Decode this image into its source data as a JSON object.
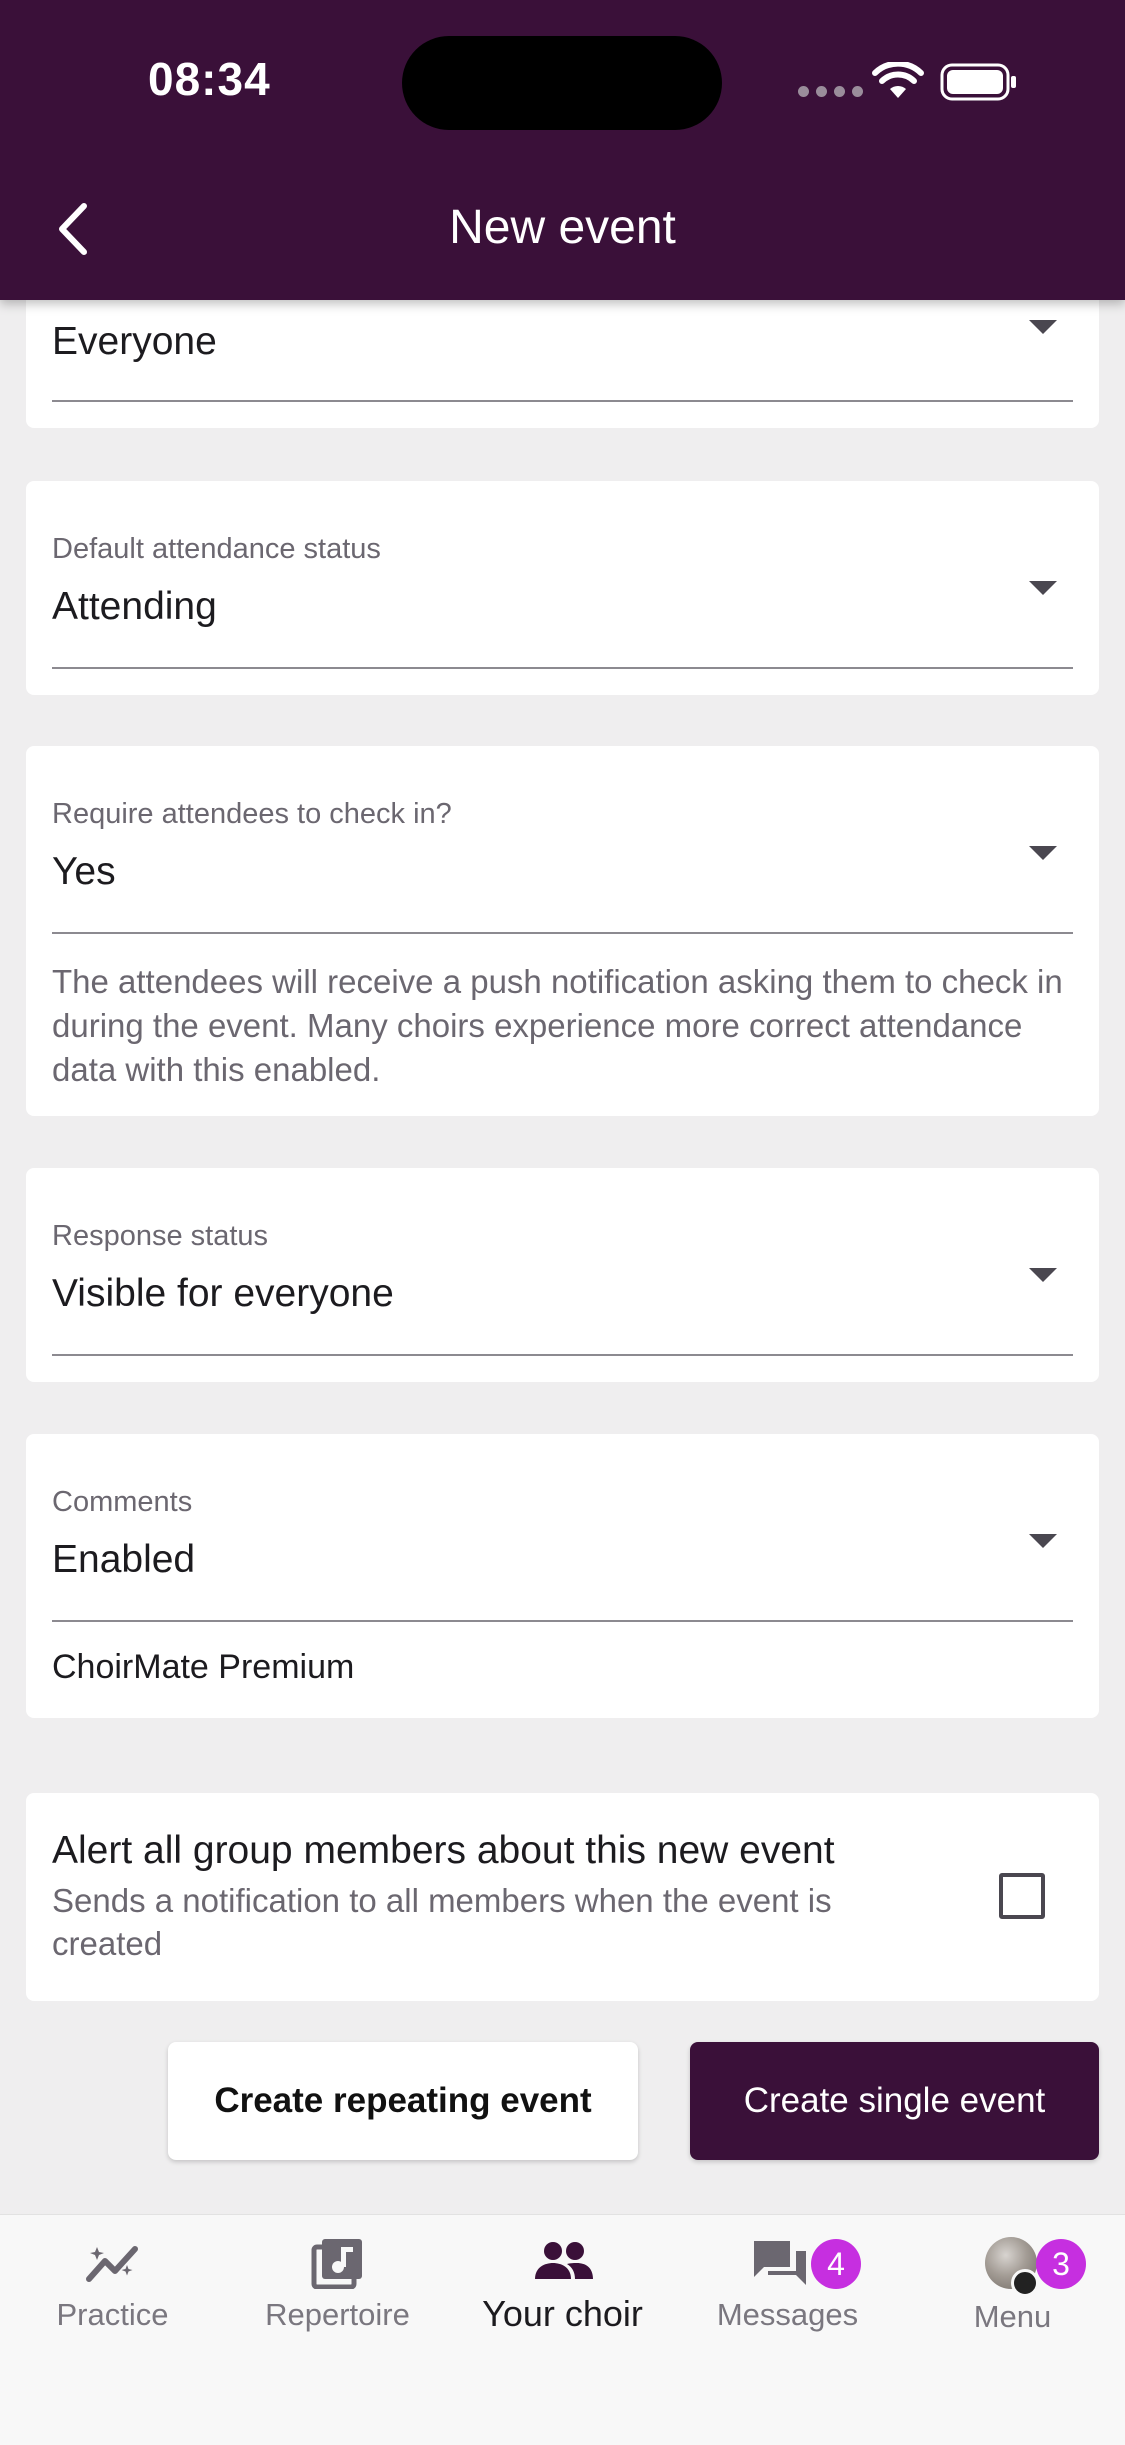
{
  "status_bar": {
    "time": "08:34"
  },
  "header": {
    "title": "New event"
  },
  "fields": {
    "visibility": {
      "value": "Everyone"
    },
    "default_attendance": {
      "label": "Default attendance status",
      "value": "Attending"
    },
    "check_in": {
      "label": "Require attendees to check in?",
      "value": "Yes",
      "helper": "The attendees will receive a push notification asking them to check in during the event. Many choirs experience more correct attendance data with this enabled."
    },
    "response_status": {
      "label": "Response status",
      "value": "Visible for everyone"
    },
    "comments": {
      "label": "Comments",
      "value": "Enabled",
      "note": "ChoirMate Premium"
    }
  },
  "alert": {
    "title": "Alert all group members about this new event",
    "subtitle": "Sends a notification to all members when the event is created",
    "checked": false
  },
  "actions": {
    "repeat_label": "Create repeating event",
    "single_label": "Create single event"
  },
  "bottom_nav": {
    "items": [
      {
        "label": "Practice",
        "icon": "trending-chart-icon"
      },
      {
        "label": "Repertoire",
        "icon": "music-library-icon"
      },
      {
        "label": "Your choir",
        "icon": "group-icon",
        "active": true
      },
      {
        "label": "Messages",
        "icon": "chat-bubbles-icon",
        "badge": "4"
      },
      {
        "label": "Menu",
        "icon": "avatar-icon",
        "badge": "3"
      }
    ]
  },
  "colors": {
    "brand": "#3a1039",
    "badge": "#c62fe0",
    "background": "#efeeef"
  }
}
